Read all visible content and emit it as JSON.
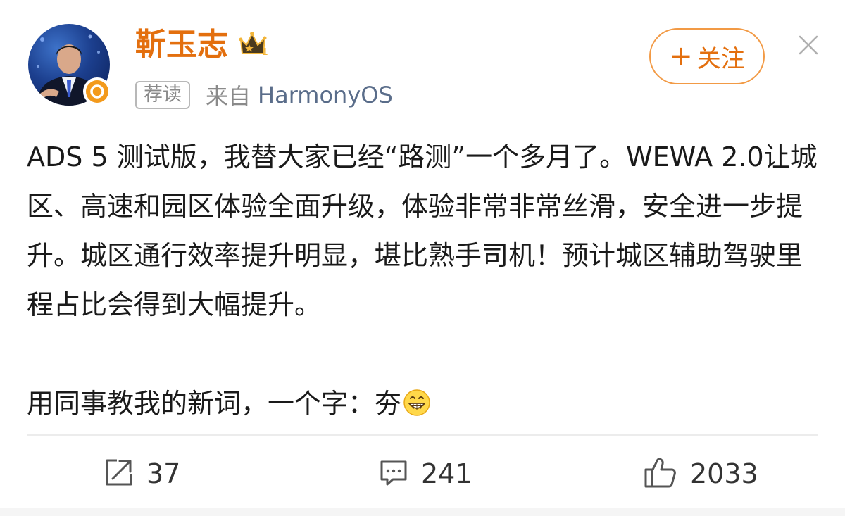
{
  "author": {
    "name": "靳玉志",
    "vip_icon": "crown-level-1-icon",
    "vip_level": "1",
    "verified_icon": "verified-badge-icon"
  },
  "meta": {
    "tag": "荐读",
    "source_prefix": "来自",
    "source_name": "HarmonyOS"
  },
  "header_actions": {
    "follow_plus": "+",
    "follow_label": "关注",
    "close_icon": "close-icon"
  },
  "post": {
    "paragraph_1": "ADS 5 测试版，我替大家已经“路测”一个多月了。WEWA 2.0让城区、高速和园区体验全面升级，体验非常非常丝滑，安全进一步提升。城区通行效率提升明显，堪比熟手司机！预计城区辅助驾驶里程占比会得到大幅提升。",
    "paragraph_2": "用同事教我的新词，一个字：夯",
    "emoji": "grin-emoji"
  },
  "actions": {
    "repost": {
      "icon": "share-icon",
      "count": "37"
    },
    "comment": {
      "icon": "comment-icon",
      "count": "241"
    },
    "like": {
      "icon": "thumbs-up-icon",
      "count": "2033"
    }
  },
  "colors": {
    "accent": "#e36f0e",
    "follow_border": "#f29a45",
    "verified": "#f39a1c",
    "meta_gray": "#8a8a8a",
    "source_blue": "#5a6d8a"
  }
}
